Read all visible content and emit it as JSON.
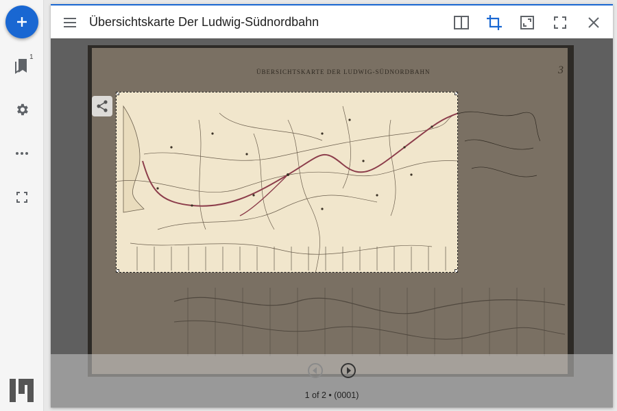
{
  "rail": {
    "add_label": "Add resource",
    "bookmark_count": "1",
    "items": [
      {
        "icon": "bookmark-icon"
      },
      {
        "icon": "gear-icon"
      },
      {
        "icon": "more-horiz-icon"
      },
      {
        "icon": "fullscreen-icon"
      }
    ],
    "logo": "mirador-logo"
  },
  "window": {
    "title": "Übersichtskarte Der Ludwig-Südnordbahn",
    "toolbar": [
      {
        "icon": "book-view-icon"
      },
      {
        "icon": "crop-icon",
        "active": true
      },
      {
        "icon": "maximize-icon"
      },
      {
        "icon": "fullscreen-icon"
      },
      {
        "icon": "close-icon"
      }
    ],
    "accent_color": "#1967d2"
  },
  "scan": {
    "heading": "ÜBERSICHTSKARTE DER LUDWIG-SÜDNORDBAHN",
    "page_mark": "3"
  },
  "footer": {
    "canvas_label": "1 of 2 • (0001)"
  }
}
